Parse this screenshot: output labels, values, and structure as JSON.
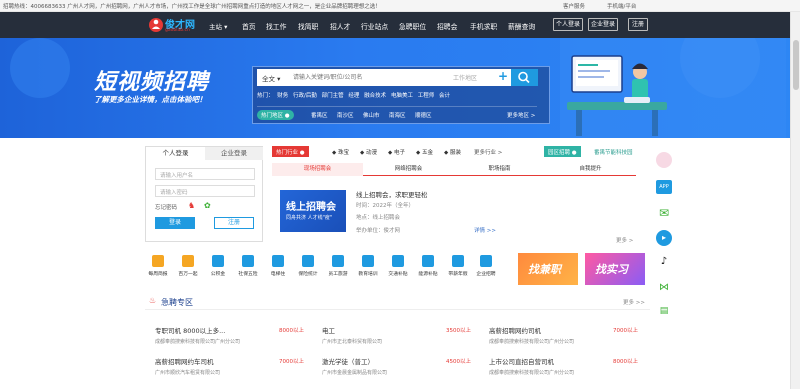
{
  "topbar": {
    "notice": "招聘热线：4006683633 广州人才网，广州招聘网，广州人才市场，广州找工作是全球广州招聘网重点打造的地区人才网之一，是企业品牌招聘理想之选！",
    "client": "客户服务",
    "mobile": "手机端/平台"
  },
  "nav": {
    "logo_text": "俊才网",
    "logo_sub": "gaoblab.cn",
    "city": "主站",
    "menu": [
      "首页",
      "找工作",
      "找简职",
      "招人才",
      "行业站点",
      "急聘职位",
      "招聘会",
      "手机求职",
      "薪酬查询"
    ],
    "personal_login": "个人登录",
    "company_login": "企业登录",
    "register": "注册"
  },
  "banner": {
    "title": "短视频招聘",
    "subtitle": "了解更多企业详情，点击体验吧！",
    "search": {
      "category": "全文",
      "placeholder": "请输入关键词/职位/公司名",
      "area_placeholder": "工作地区",
      "hot_label": "热门：",
      "hot_words": [
        "财务",
        "行政/后勤",
        "部门主管",
        "经理",
        "融合技术",
        "电脑美工",
        "工程师",
        "会计"
      ],
      "area_tag": "热门地区",
      "areas": [
        "番禺区",
        "南沙区",
        "佛山市",
        "南海区",
        "顺德区"
      ],
      "more_areas": "更多地区 >"
    }
  },
  "login": {
    "tab_personal": "个人登录",
    "tab_company": "企业登录",
    "username_placeholder": "请输入用户名",
    "password_placeholder": "请输入密码",
    "extra": "忘记密码",
    "login_btn": "登录",
    "register_btn": "注册"
  },
  "industry": {
    "tag": "热门行业",
    "items": [
      "珠宝",
      "动漫",
      "电子",
      "五金",
      "服装"
    ],
    "more": "更多行业 >",
    "park_tag": "园区招聘",
    "park_item": "番禺节能科技园"
  },
  "job_tabs": [
    "现场招聘会",
    "网络招聘会",
    "职场指南",
    "自我提升"
  ],
  "fair": {
    "banner_title": "线上招聘会",
    "banner_sub": "同舟共济 人才线\"疫\"",
    "title": "线上招聘会，求职更轻松",
    "time": "时间：2022年（全年）",
    "location": "地点：线上招聘会",
    "organizer": "举办单位：俊才网",
    "detail": "详情 >>",
    "more": "更多 >"
  },
  "quick_icons": [
    "每周简报",
    "百万一起",
    "公积金",
    "社保五险",
    "电梯住",
    "保险统计",
    "员工旅游",
    "教育培训",
    "交通补贴",
    "能源补贴",
    "带薪年假",
    "企业招聘"
  ],
  "promos": {
    "part_time": "找兼职",
    "intern": "找实习"
  },
  "urgent": {
    "title": "急聘专区",
    "more": "更多 >>",
    "jobs": [
      {
        "title": "专职司机 8000以上多...",
        "salary": "8000以上",
        "company": "成都奉鸽搜索科技有限公司广州分公司"
      },
      {
        "title": "电工",
        "salary": "3500以上",
        "company": "广州市正北泰科贸有限公司"
      },
      {
        "title": "高薪招聘网约司机",
        "salary": "7000以上",
        "company": "成都奉鸽搜索科技有限公司广州分公司"
      },
      {
        "title": "高薪招聘网约车司机",
        "salary": "7000以上",
        "company": "广州市顺欣汽车租赁有限公司"
      },
      {
        "title": "激光学徒（普工）",
        "salary": "4500以上",
        "company": "广州市金晨金属制品有限公司"
      },
      {
        "title": "上市公司直招自营司机",
        "salary": "8000以上",
        "company": "成都奉鸽搜索科技有限公司广州分公司"
      }
    ]
  },
  "colors": {
    "nav_bg": "#262e3b",
    "banner": "#2a7bf0",
    "accent_red": "#e53935",
    "accent_blue": "#1f9ae0"
  }
}
